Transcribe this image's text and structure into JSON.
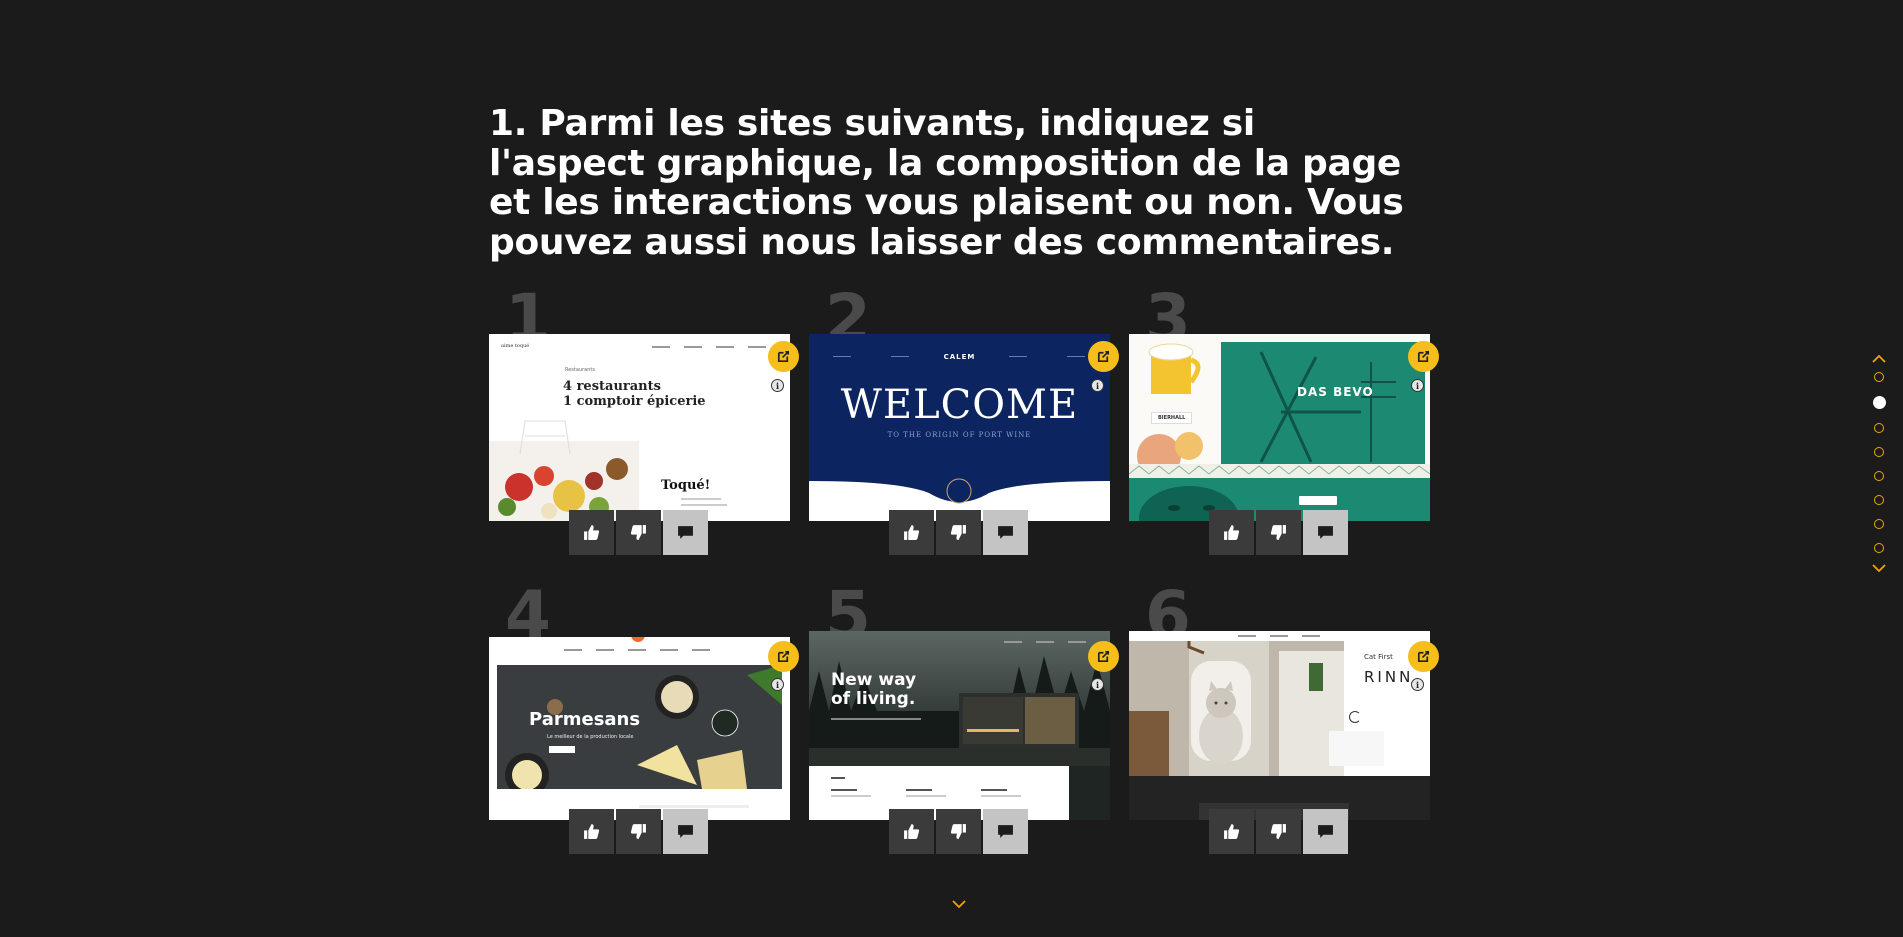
{
  "question": {
    "title": "1. Parmi les sites suivants, indiquez si l'aspect graphique, la composition de la page et les interactions vous plaisent ou non. Vous pouvez aussi nous laisser des commentaires."
  },
  "colors": {
    "background": "#1b1b1b",
    "accent": "#f6be1a",
    "number": "#4a4a4a"
  },
  "icons": {
    "edit": "external-edit-icon",
    "info": "info-icon",
    "like": "thumbs-up-icon",
    "dislike": "thumbs-down-icon",
    "comment": "comment-icon",
    "nav_up": "chevron-up-icon",
    "nav_down": "chevron-down-icon"
  },
  "sites": [
    {
      "number": "1",
      "brand": "aime toqué",
      "headline_1": "4 restaurants",
      "headline_2": "1 comptoir épicerie",
      "label_small": "Restaurants",
      "sub": "Toqué!"
    },
    {
      "number": "2",
      "brand": "CALEM",
      "headline": "WELCOME",
      "sub": "TO THE ORIGIN OF PORT WINE"
    },
    {
      "number": "3",
      "headline": "DAS BEVO",
      "label_small": "BIERHALL"
    },
    {
      "number": "4",
      "headline": "Parmesans",
      "sub": "Le meilleur de la production locale"
    },
    {
      "number": "5",
      "headline_1": "New way",
      "headline_2": "of living."
    },
    {
      "number": "6",
      "label_small": "Cat First",
      "headline": "RINN"
    }
  ],
  "section_nav": {
    "count": 8,
    "active_index": 1
  }
}
